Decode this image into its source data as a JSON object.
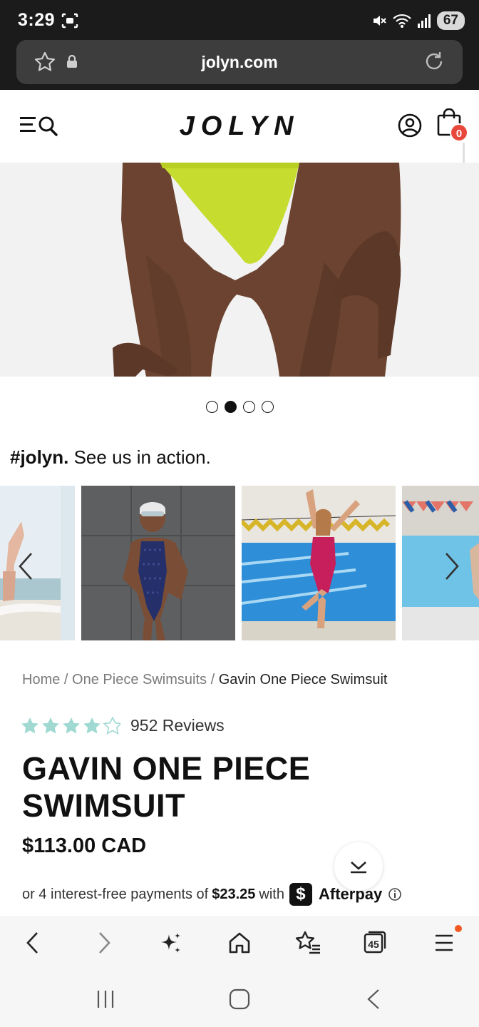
{
  "status_bar": {
    "time": "3:29",
    "battery": "67"
  },
  "browser": {
    "url": "jolyn.com",
    "tab_count": "45"
  },
  "site": {
    "logo": "JOLYN",
    "cart_count": "0"
  },
  "hero": {
    "slide_count": 4,
    "active_slide": 2
  },
  "gallery": {
    "hashtag": "#jolyn.",
    "caption": "See us in action."
  },
  "breadcrumb": {
    "home": "Home",
    "sep": "/",
    "category": "One Piece Swimsuits",
    "current": "Gavin One Piece Swimsuit"
  },
  "product": {
    "rating": 4.5,
    "reviews": "952 Reviews",
    "title": "GAVIN ONE PIECE SWIMSUIT",
    "price": "$113.00 CAD"
  },
  "afterpay": {
    "prefix": "or 4 interest-free payments of",
    "amount": "$23.25",
    "with": "with",
    "brand": "Afterpay"
  },
  "colors": {
    "accent_badge": "#e8473c",
    "star": "#9fd9d2",
    "swimsuit_lime": "#c6dc2e"
  }
}
